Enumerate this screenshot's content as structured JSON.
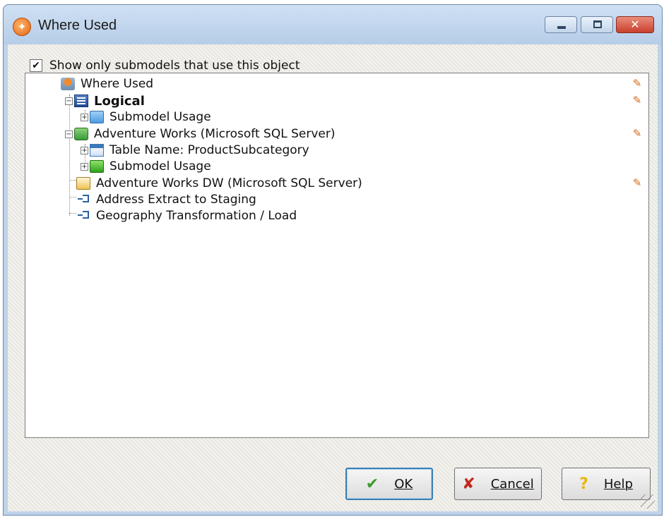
{
  "window": {
    "title": "Where Used",
    "controls": {
      "minimize": "minimize",
      "maximize": "maximize",
      "close": "✕"
    }
  },
  "filter": {
    "checked": true,
    "label": "Show only submodels that use this object"
  },
  "tree": {
    "root": "Where Used",
    "logical": "Logical",
    "logical_submodel": "Submodel Usage",
    "aw": "Adventure Works (Microsoft SQL Server)",
    "aw_table": "Table Name: ProductSubcategory",
    "aw_submodel": "Submodel Usage",
    "awdw": "Adventure Works DW (Microsoft SQL Server)",
    "address_extract": "Address Extract to Staging",
    "geo_transform": "Geography Transformation / Load"
  },
  "buttons": {
    "ok": "OK",
    "cancel": "Cancel",
    "help": "Help"
  },
  "colors": {
    "accent_default_button": "#3c7fb1",
    "edit_pencil": "#d56a1a",
    "close_button": "#c7402c"
  }
}
